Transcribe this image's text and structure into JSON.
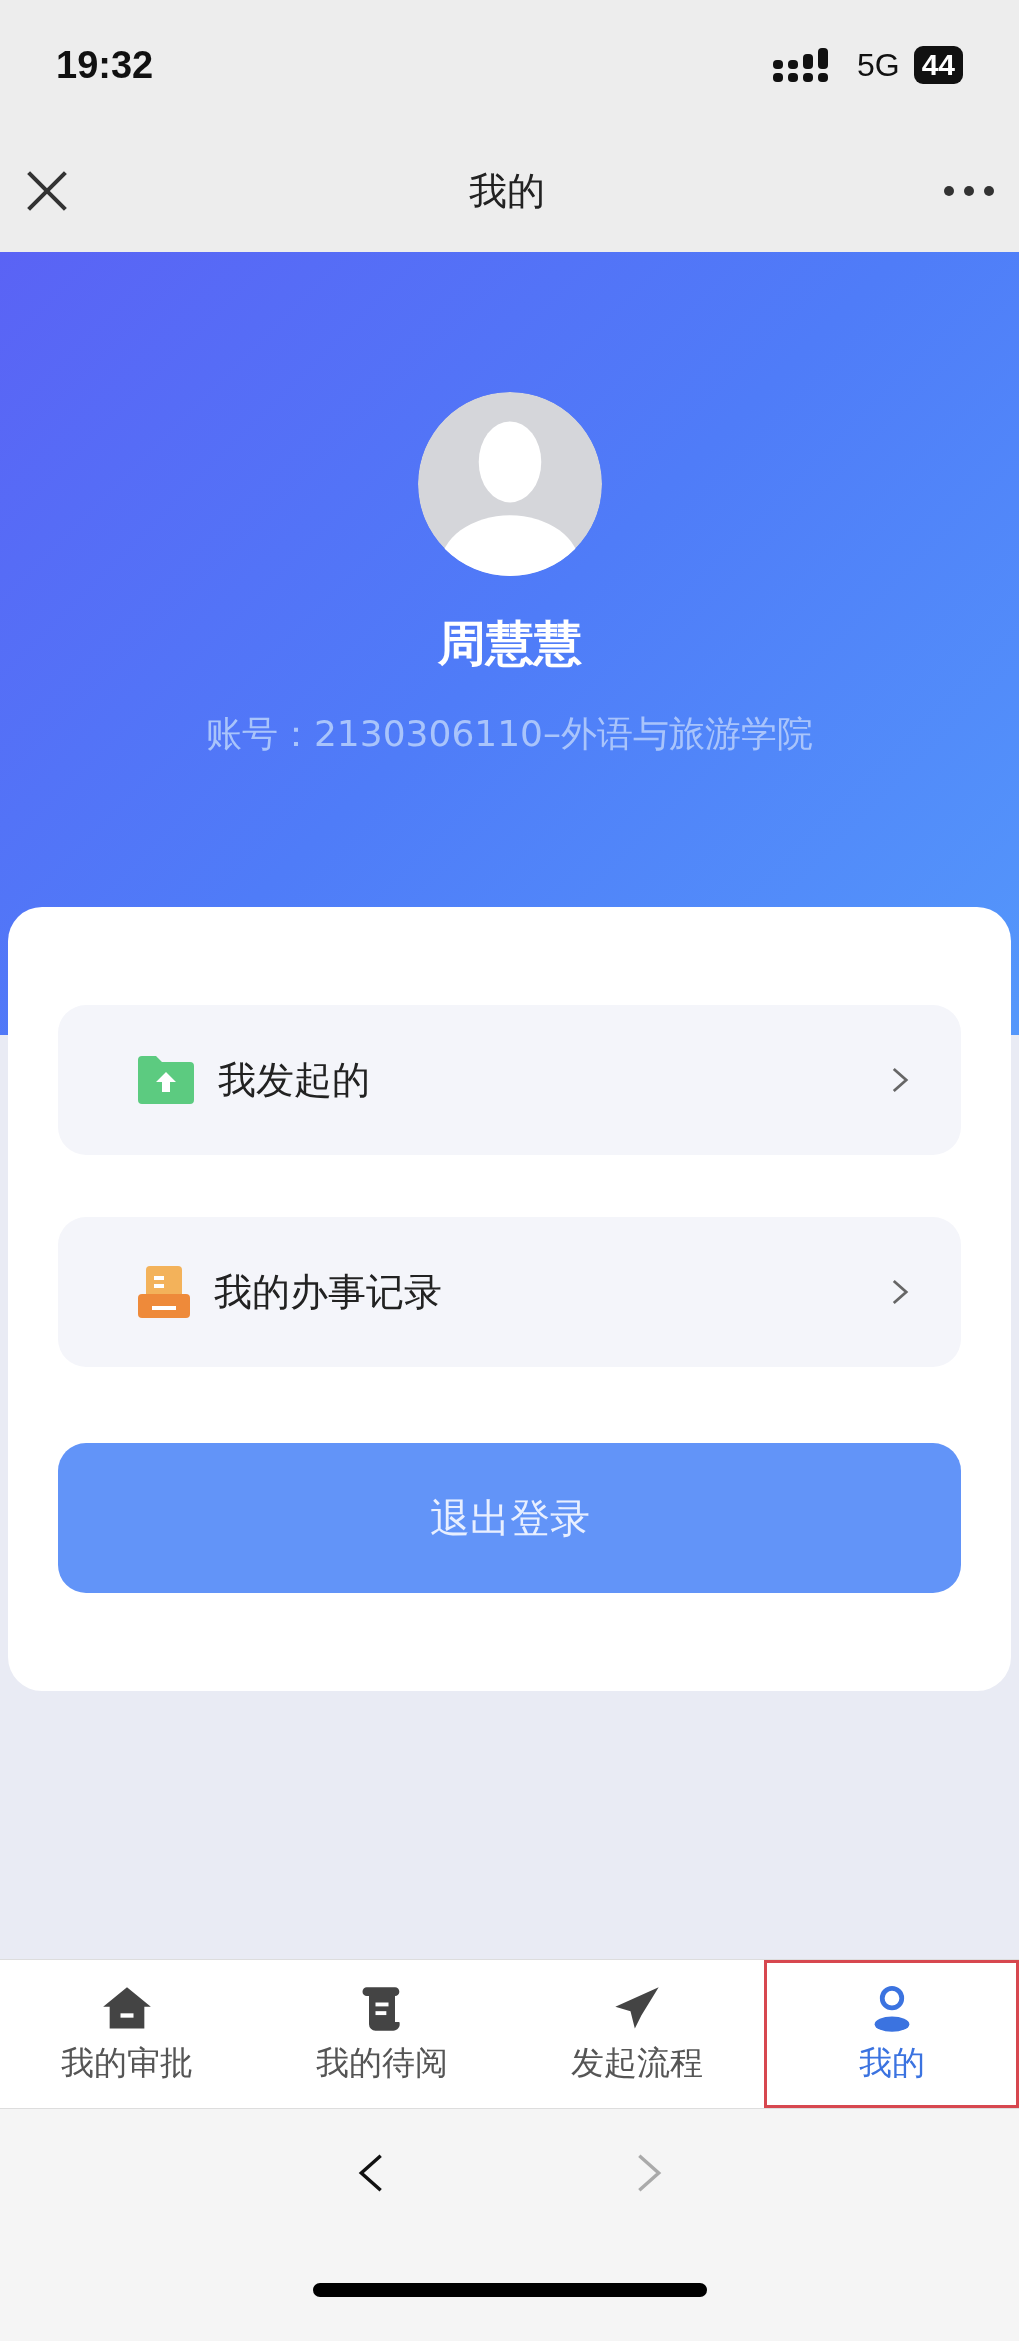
{
  "status_bar": {
    "time": "19:32",
    "network": "5G",
    "battery": "44"
  },
  "nav_bar": {
    "title": "我的"
  },
  "profile": {
    "name": "周慧慧",
    "account": "账号：2130306110–外语与旅游学院"
  },
  "menu": [
    {
      "kind": "initiated",
      "label": "我发起的"
    },
    {
      "kind": "records",
      "label": "我的办事记录"
    }
  ],
  "logout_button": "退出登录",
  "tabs": [
    {
      "kind": "home",
      "label": "我的审批",
      "selected": false
    },
    {
      "kind": "scroll",
      "label": "我的待阅",
      "selected": false
    },
    {
      "kind": "plane",
      "label": "发起流程",
      "selected": false
    },
    {
      "kind": "person",
      "label": "我的",
      "selected": true
    }
  ],
  "browser_toolbar": {
    "back_disabled": false,
    "forward_disabled": true
  }
}
